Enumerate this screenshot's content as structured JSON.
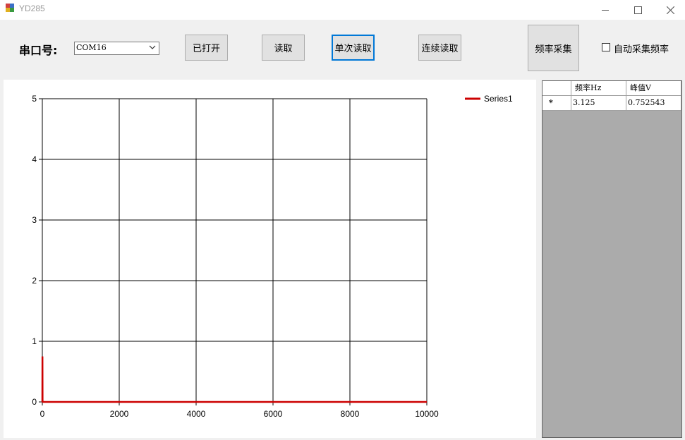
{
  "window": {
    "title": "YD285"
  },
  "toolbar": {
    "port_label": "串口号:",
    "port_value": "COM16",
    "open_label": "已打开",
    "read_label": "读取",
    "single_read_label": "单次读取",
    "continuous_read_label": "连续读取",
    "freq_sample_label": "频率采集",
    "auto_sample_label": "自动采集频率",
    "auto_sample_checked": false
  },
  "grid": {
    "columns": [
      "",
      "频率Hz",
      "峰值V"
    ],
    "rows": [
      {
        "marker": "*",
        "freq": "3.125",
        "peak": "0.752543"
      }
    ]
  },
  "chart_data": {
    "type": "line",
    "legend": "top-right",
    "grid": true,
    "xlim": [
      0,
      10000
    ],
    "ylim": [
      0,
      5
    ],
    "xticks": [
      "0",
      "2000",
      "4000",
      "6000",
      "8000",
      "10000"
    ],
    "yticks": [
      "0",
      "1",
      "2",
      "3",
      "4",
      "5"
    ],
    "series": [
      {
        "name": "Series1",
        "color": "#cc0000",
        "x": [
          0,
          3.125,
          6.25,
          12.5,
          50,
          10000
        ],
        "y": [
          0,
          0.75,
          0.02,
          0.0,
          0.0,
          0.0
        ]
      }
    ]
  }
}
